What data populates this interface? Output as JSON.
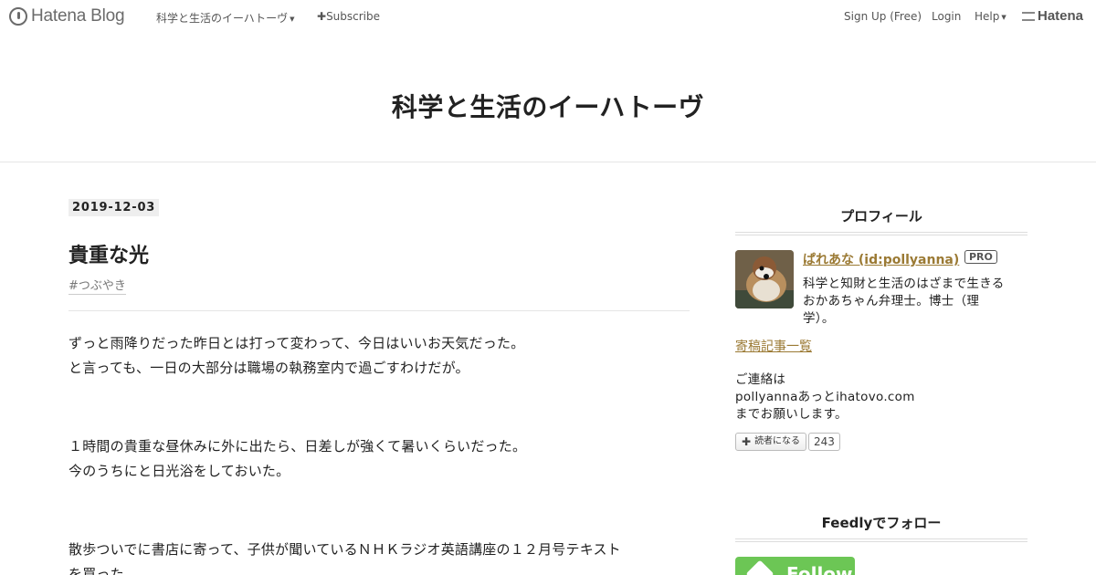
{
  "globalbar": {
    "logo_text": "Hatena Blog",
    "blog_menu": "科学と生活のイーハトーヴ",
    "subscribe": "Subscribe",
    "signup": "Sign Up (Free)",
    "login": "Login",
    "help": "Help",
    "hatena": "Hatena"
  },
  "blog": {
    "title": "科学と生活のイーハトーヴ"
  },
  "entry": {
    "date": "2019-12-03",
    "title": "貴重な光",
    "tag": "#つぶやき",
    "lines": [
      "ずっと雨降りだった昨日とは打って変わって、今日はいいお天気だった。",
      "と言っても、一日の大部分は職場の執務室内で過ごすわけだが。",
      "１時間の貴重な昼休みに外に出たら、日差しが強くて暑いくらいだった。",
      "今のうちにと日光浴をしておいた。",
      "散歩ついでに書店に寄って、子供が聞いているＮＨＫラジオ英語講座の１２月号テキスト",
      "を買った。"
    ]
  },
  "sidebar": {
    "profile_heading": "プロフィール",
    "profile_name": "ぱれあな (id:pollyanna)",
    "pro_badge": "PRO",
    "profile_desc": [
      "科学と知財と生活のはざまで生きる",
      "おかあちゃん弁理士。博士（理",
      "学）。"
    ],
    "archive_link": "寄稿記事一覧",
    "contact": [
      "ご連絡は",
      "pollyannaあっとihatovo.com",
      "までお願いします。"
    ],
    "reader_button": "読者になる",
    "reader_count": "243",
    "feedly_heading": "Feedlyでフォロー",
    "follow_button": "Follow"
  },
  "icons": {
    "hatena_blog_logo": "hatena-blog-logo-icon",
    "plus": "plus-icon",
    "caret": "caret-down-icon",
    "feedly": "feedly-icon"
  },
  "colors": {
    "link": "#9b7a34",
    "feedly_green": "#6cc655"
  }
}
